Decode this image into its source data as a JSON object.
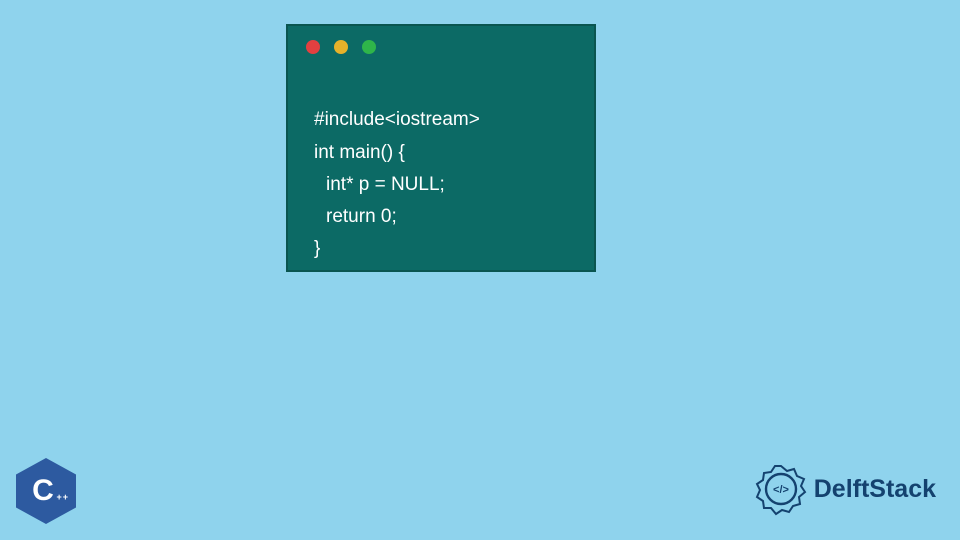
{
  "window": {
    "dots": [
      "red",
      "yellow",
      "green"
    ]
  },
  "code": {
    "line1": "#include<iostream>",
    "line2": "int main() {",
    "line3": "int* p = NULL;",
    "line4": "return 0;",
    "line5": "}"
  },
  "badges": {
    "cpp_letter": "C",
    "cpp_pluses": "++",
    "delft_text": "DelftStack",
    "delft_inner": "</>"
  },
  "colors": {
    "bg": "#8fd3ed",
    "window": "#0c6a65",
    "cpp": "#2d5aa0",
    "delft": "#14426f"
  }
}
